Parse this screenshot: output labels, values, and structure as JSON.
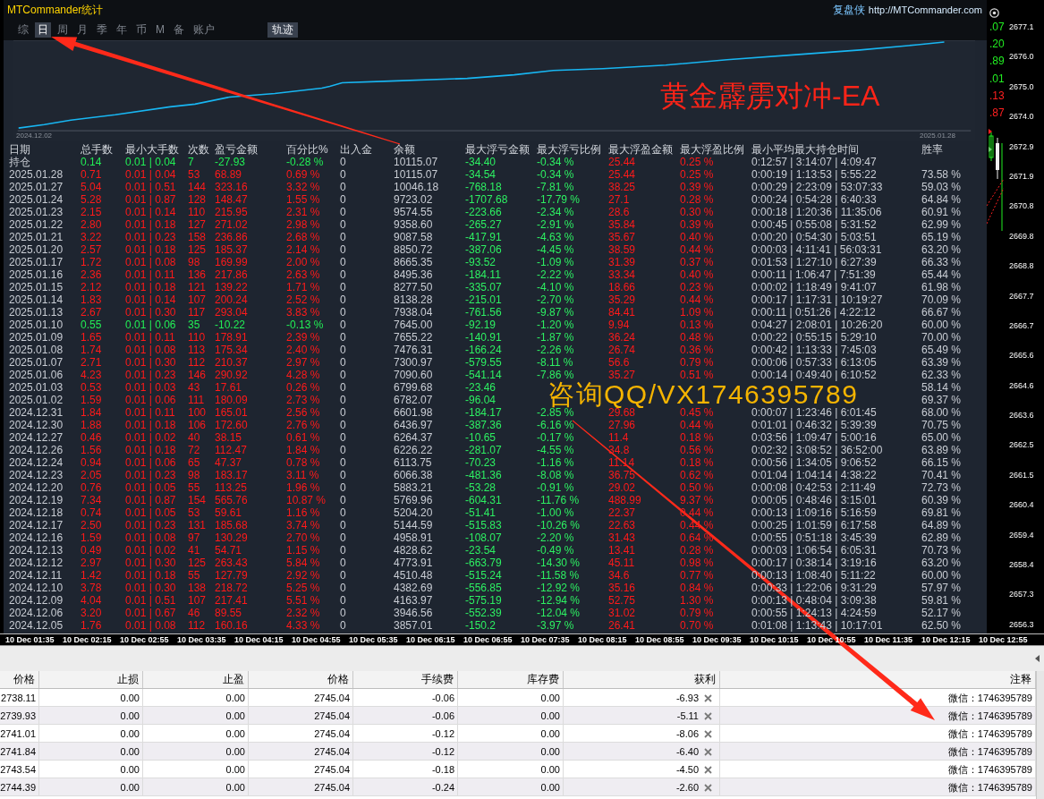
{
  "window": {
    "title": "MTCommander统计",
    "brand": "复盘侠",
    "url": "http://MTCommander.com"
  },
  "tabs": [
    {
      "label": "综",
      "selected": false
    },
    {
      "label": "日",
      "selected": true
    },
    {
      "label": "周",
      "selected": false
    },
    {
      "label": "月",
      "selected": false
    },
    {
      "label": "季",
      "selected": false
    },
    {
      "label": "年",
      "selected": false
    },
    {
      "label": "币",
      "selected": false
    },
    {
      "label": "M",
      "selected": false
    },
    {
      "label": "备",
      "selected": false
    },
    {
      "label": "账户",
      "selected": false
    }
  ],
  "track_button": {
    "label": "轨迹"
  },
  "equity_chart": {
    "start_label": "2024.12.02",
    "end_label": "2025.01.28"
  },
  "stats_table": {
    "columns": [
      "日期",
      "总手数",
      "最小大手数",
      "次数",
      "盈亏金额",
      "百分比%",
      "出入金",
      "余额",
      "最大浮亏金额",
      "最大浮亏比例",
      "最大浮盈金额",
      "最大浮盈比例",
      "最小平均最大持仓时间",
      "胜率"
    ],
    "rows": [
      {
        "color": "#22ee55",
        "cells": [
          "持仓",
          "0.14",
          "0.01 | 0.04",
          "7",
          "-27.93",
          "-0.28 %",
          "0",
          "10115.07",
          "-34.40",
          "-0.34 %",
          "25.44",
          "0.25 %",
          "0:12:57 | 3:14:07 | 4:09:47",
          null
        ]
      },
      {
        "color": "#ff1a1a",
        "cells": [
          "2025.01.28",
          "0.71",
          "0.01 | 0.04",
          "53",
          "68.89",
          "0.69 %",
          "0",
          "10115.07",
          "-34.54",
          "-0.34 %",
          "25.44",
          "0.25 %",
          "0:00:19 | 1:13:53 | 5:55:22",
          "73.58 %"
        ]
      },
      {
        "color": "#ff1a1a",
        "cells": [
          "2025.01.27",
          "5.04",
          "0.01 | 0.51",
          "144",
          "323.16",
          "3.32 %",
          "0",
          "10046.18",
          "-768.18",
          "-7.81 %",
          "38.25",
          "0.39 %",
          "0:00:29 | 2:23:09 | 53:07:33",
          "59.03 %"
        ]
      },
      {
        "color": "#ff1a1a",
        "cells": [
          "2025.01.24",
          "5.28",
          "0.01 | 0.87",
          "128",
          "148.47",
          "1.55 %",
          "0",
          "9723.02",
          "-1707.68",
          "-17.79 %",
          "27.1",
          "0.28 %",
          "0:00:24 | 0:54:28 | 6:40:33",
          "64.84 %"
        ]
      },
      {
        "color": "#ff1a1a",
        "cells": [
          "2025.01.23",
          "2.15",
          "0.01 | 0.14",
          "110",
          "215.95",
          "2.31 %",
          "0",
          "9574.55",
          "-223.66",
          "-2.34 %",
          "28.6",
          "0.30 %",
          "0:00:18 | 1:20:36 | 11:35:06",
          "60.91 %"
        ]
      },
      {
        "color": "#ff1a1a",
        "cells": [
          "2025.01.22",
          "2.80",
          "0.01 | 0.18",
          "127",
          "271.02",
          "2.98 %",
          "0",
          "9358.60",
          "-265.27",
          "-2.91 %",
          "35.84",
          "0.39 %",
          "0:00:45 | 0:55:08 | 5:31:52",
          "62.99 %"
        ]
      },
      {
        "color": "#ff1a1a",
        "cells": [
          "2025.01.21",
          "3.22",
          "0.01 | 0.23",
          "158",
          "236.86",
          "2.68 %",
          "0",
          "9087.58",
          "-417.91",
          "-4.63 %",
          "35.67",
          "0.40 %",
          "0:00:20 | 0:54:30 | 5:03:51",
          "65.19 %"
        ]
      },
      {
        "color": "#ff1a1a",
        "cells": [
          "2025.01.20",
          "2.57",
          "0.01 | 0.18",
          "125",
          "185.37",
          "2.14 %",
          "0",
          "8850.72",
          "-387.06",
          "-4.45 %",
          "38.59",
          "0.44 %",
          "0:00:03 | 4:11:41 | 56:03:31",
          "63.20 %"
        ]
      },
      {
        "color": "#ff1a1a",
        "cells": [
          "2025.01.17",
          "1.72",
          "0.01 | 0.08",
          "98",
          "169.99",
          "2.00 %",
          "0",
          "8665.35",
          "-93.52",
          "-1.09 %",
          "31.39",
          "0.37 %",
          "0:01:53 | 1:27:10 | 6:27:39",
          "66.33 %"
        ]
      },
      {
        "color": "#ff1a1a",
        "cells": [
          "2025.01.16",
          "2.36",
          "0.01 | 0.11",
          "136",
          "217.86",
          "2.63 %",
          "0",
          "8495.36",
          "-184.11",
          "-2.22 %",
          "33.34",
          "0.40 %",
          "0:00:11 | 1:06:47 | 7:51:39",
          "65.44 %"
        ]
      },
      {
        "color": "#ff1a1a",
        "cells": [
          "2025.01.15",
          "2.12",
          "0.01 | 0.18",
          "121",
          "139.22",
          "1.71 %",
          "0",
          "8277.50",
          "-335.07",
          "-4.10 %",
          "18.66",
          "0.23 %",
          "0:00:02 | 1:18:49 | 9:41:07",
          "61.98 %"
        ]
      },
      {
        "color": "#ff1a1a",
        "cells": [
          "2025.01.14",
          "1.83",
          "0.01 | 0.14",
          "107",
          "200.24",
          "2.52 %",
          "0",
          "8138.28",
          "-215.01",
          "-2.70 %",
          "35.29",
          "0.44 %",
          "0:00:17 | 1:17:31 | 10:19:27",
          "70.09 %"
        ]
      },
      {
        "color": "#ff1a1a",
        "cells": [
          "2025.01.13",
          "2.67",
          "0.01 | 0.30",
          "117",
          "293.04",
          "3.83 %",
          "0",
          "7938.04",
          "-761.56",
          "-9.87 %",
          "84.41",
          "1.09 %",
          "0:00:11 | 0:51:26 | 4:22:12",
          "66.67 %"
        ]
      },
      {
        "color": "#22ee55",
        "cells": [
          "2025.01.10",
          "0.55",
          "0.01 | 0.06",
          "35",
          "-10.22",
          "-0.13 %",
          "0",
          "7645.00",
          "-92.19",
          "-1.20 %",
          "9.94",
          "0.13 %",
          "0:04:27 | 2:08:01 | 10:26:20",
          "60.00 %"
        ]
      },
      {
        "color": "#ff1a1a",
        "cells": [
          "2025.01.09",
          "1.65",
          "0.01 | 0.11",
          "110",
          "178.91",
          "2.39 %",
          "0",
          "7655.22",
          "-140.91",
          "-1.87 %",
          "36.24",
          "0.48 %",
          "0:00:22 | 0:55:15 | 5:29:10",
          "70.00 %"
        ]
      },
      {
        "color": "#ff1a1a",
        "cells": [
          "2025.01.08",
          "1.74",
          "0.01 | 0.08",
          "113",
          "175.34",
          "2.40 %",
          "0",
          "7476.31",
          "-166.24",
          "-2.26 %",
          "26.74",
          "0.36 %",
          "0:00:42 | 1:13:33 | 7:45:03",
          "65.49 %"
        ]
      },
      {
        "color": "#ff1a1a",
        "cells": [
          "2025.01.07",
          "2.71",
          "0.01 | 0.30",
          "112",
          "210.37",
          "2.97 %",
          "0",
          "7300.97",
          "-579.55",
          "-8.11 %",
          "56.6",
          "0.79 %",
          "0:00:06 | 0:57:33 | 6:13:05",
          "63.39 %"
        ]
      },
      {
        "color": "#ff1a1a",
        "cells": [
          "2025.01.06",
          "4.23",
          "0.01 | 0.23",
          "146",
          "290.92",
          "4.28 %",
          "0",
          "7090.60",
          "-541.14",
          "-7.86 %",
          "35.27",
          "0.51 %",
          "0:00:14 | 0:49:40 | 6:10:52",
          "62.33 %"
        ]
      },
      {
        "color": "#ff1a1a",
        "cells": [
          "2025.01.03",
          "0.53",
          "0.01 | 0.03",
          "43",
          "17.61",
          "0.26 %",
          "0",
          "6799.68",
          "-23.46",
          null,
          null,
          null,
          null,
          "58.14 %"
        ]
      },
      {
        "color": "#ff1a1a",
        "cells": [
          "2025.01.02",
          "1.59",
          "0.01 | 0.06",
          "111",
          "180.09",
          "2.73 %",
          "0",
          "6782.07",
          "-96.04",
          null,
          null,
          null,
          null,
          "69.37 %"
        ]
      },
      {
        "color": "#ff1a1a",
        "cells": [
          "2024.12.31",
          "1.84",
          "0.01 | 0.11",
          "100",
          "165.01",
          "2.56 %",
          "0",
          "6601.98",
          "-184.17",
          "-2.85 %",
          "29.68",
          "0.45 %",
          "0:00:07 | 1:23:46 | 6:01:45",
          "68.00 %"
        ]
      },
      {
        "color": "#ff1a1a",
        "cells": [
          "2024.12.30",
          "1.88",
          "0.01 | 0.18",
          "106",
          "172.60",
          "2.76 %",
          "0",
          "6436.97",
          "-387.36",
          "-6.16 %",
          "27.96",
          "0.44 %",
          "0:01:01 | 0:46:32 | 5:39:39",
          "70.75 %"
        ]
      },
      {
        "color": "#ff1a1a",
        "cells": [
          "2024.12.27",
          "0.46",
          "0.01 | 0.02",
          "40",
          "38.15",
          "0.61 %",
          "0",
          "6264.37",
          "-10.65",
          "-0.17 %",
          "11.4",
          "0.18 %",
          "0:03:56 | 1:09:47 | 5:00:16",
          "65.00 %"
        ]
      },
      {
        "color": "#ff1a1a",
        "cells": [
          "2024.12.26",
          "1.56",
          "0.01 | 0.18",
          "72",
          "112.47",
          "1.84 %",
          "0",
          "6226.22",
          "-281.07",
          "-4.55 %",
          "34.8",
          "0.56 %",
          "0:02:32 | 3:08:52 | 36:52:00",
          "63.89 %"
        ]
      },
      {
        "color": "#ff1a1a",
        "cells": [
          "2024.12.24",
          "0.94",
          "0.01 | 0.06",
          "65",
          "47.37",
          "0.78 %",
          "0",
          "6113.75",
          "-70.23",
          "-1.16 %",
          "11.14",
          "0.18 %",
          "0:00:56 | 1:34:05 | 9:06:52",
          "66.15 %"
        ]
      },
      {
        "color": "#ff1a1a",
        "cells": [
          "2024.12.23",
          "2.05",
          "0.01 | 0.23",
          "98",
          "183.17",
          "3.11 %",
          "0",
          "6066.38",
          "-481.36",
          "-8.08 %",
          "36.75",
          "0.62 %",
          "0:01:04 | 1:04:14 | 4:38:22",
          "70.41 %"
        ]
      },
      {
        "color": "#ff1a1a",
        "cells": [
          "2024.12.20",
          "0.76",
          "0.01 | 0.05",
          "55",
          "113.25",
          "1.96 %",
          "0",
          "5883.21",
          "-53.28",
          "-0.91 %",
          "29.02",
          "0.50 %",
          "0:00:08 | 0:42:53 | 2:11:49",
          "72.73 %"
        ]
      },
      {
        "color": "#ff1a1a",
        "cells": [
          "2024.12.19",
          "7.34",
          "0.01 | 0.87",
          "154",
          "565.76",
          "10.87 %",
          "0",
          "5769.96",
          "-604.31",
          "-11.76 %",
          "488.99",
          "9.37 %",
          "0:00:05 | 0:48:46 | 3:15:01",
          "60.39 %"
        ]
      },
      {
        "color": "#ff1a1a",
        "cells": [
          "2024.12.18",
          "0.74",
          "0.01 | 0.05",
          "53",
          "59.61",
          "1.16 %",
          "0",
          "5204.20",
          "-51.41",
          "-1.00 %",
          "22.37",
          "0.44 %",
          "0:00:13 | 1:09:16 | 5:16:59",
          "69.81 %"
        ]
      },
      {
        "color": "#ff1a1a",
        "cells": [
          "2024.12.17",
          "2.50",
          "0.01 | 0.23",
          "131",
          "185.68",
          "3.74 %",
          "0",
          "5144.59",
          "-515.83",
          "-10.26 %",
          "22.63",
          "0.44 %",
          "0:00:25 | 1:01:59 | 6:17:58",
          "64.89 %"
        ]
      },
      {
        "color": "#ff1a1a",
        "cells": [
          "2024.12.16",
          "1.59",
          "0.01 | 0.08",
          "97",
          "130.29",
          "2.70 %",
          "0",
          "4958.91",
          "-108.07",
          "-2.20 %",
          "31.43",
          "0.64 %",
          "0:00:55 | 0:51:18 | 3:45:39",
          "62.89 %"
        ]
      },
      {
        "color": "#ff1a1a",
        "cells": [
          "2024.12.13",
          "0.49",
          "0.01 | 0.02",
          "41",
          "54.71",
          "1.15 %",
          "0",
          "4828.62",
          "-23.54",
          "-0.49 %",
          "13.41",
          "0.28 %",
          "0:00:03 | 1:06:54 | 6:05:31",
          "70.73 %"
        ]
      },
      {
        "color": "#ff1a1a",
        "cells": [
          "2024.12.12",
          "2.97",
          "0.01 | 0.30",
          "125",
          "263.43",
          "5.84 %",
          "0",
          "4773.91",
          "-663.79",
          "-14.30 %",
          "45.11",
          "0.98 %",
          "0:00:17 | 0:38:14 | 3:19:16",
          "63.20 %"
        ]
      },
      {
        "color": "#ff1a1a",
        "cells": [
          "2024.12.11",
          "1.42",
          "0.01 | 0.18",
          "55",
          "127.79",
          "2.92 %",
          "0",
          "4510.48",
          "-515.24",
          "-11.58 %",
          "34.6",
          "0.77 %",
          "0:00:13 | 1:08:40 | 5:11:22",
          "60.00 %"
        ]
      },
      {
        "color": "#ff1a1a",
        "cells": [
          "2024.12.10",
          "3.78",
          "0.01 | 0.30",
          "138",
          "218.72",
          "5.25 %",
          "0",
          "4382.69",
          "-556.85",
          "-12.92 %",
          "35.16",
          "0.84 %",
          "0:00:33 | 1:22:06 | 9:31:29",
          "57.97 %"
        ]
      },
      {
        "color": "#ff1a1a",
        "cells": [
          "2024.12.09",
          "4.04",
          "0.01 | 0.51",
          "107",
          "217.41",
          "5.51 %",
          "0",
          "4163.97",
          "-575.19",
          "-12.94 %",
          "52.75",
          "1.30 %",
          "0:00:13 | 0:48:04 | 3:09:38",
          "59.81 %"
        ]
      },
      {
        "color": "#ff1a1a",
        "cells": [
          "2024.12.06",
          "3.20",
          "0.01 | 0.67",
          "46",
          "89.55",
          "2.32 %",
          "0",
          "3946.56",
          "-552.39",
          "-12.04 %",
          "31.02",
          "0.79 %",
          "0:00:55 | 1:24:13 | 4:24:59",
          "52.17 %"
        ]
      },
      {
        "color": "#ff1a1a",
        "cells": [
          "2024.12.05",
          "1.76",
          "0.01 | 0.08",
          "112",
          "160.16",
          "4.33 %",
          "0",
          "3857.01",
          "-150.2",
          "-3.97 %",
          "26.41",
          "0.70 %",
          "0:01:08 | 1:13:43 | 10:17:01",
          "62.50 %"
        ]
      }
    ]
  },
  "quote_values": [
    {
      "text": ".07",
      "color": "#22ee22"
    },
    {
      "text": ".20",
      "color": "#22ee22"
    },
    {
      "text": ".89",
      "color": "#22ee22"
    },
    {
      "text": ".01",
      "color": "#22ee22"
    },
    {
      "text": ".13",
      "color": "#ff2020"
    },
    {
      "text": ".87",
      "color": "#ff2020"
    }
  ],
  "price_axis": [
    "2677.1",
    "2676.0",
    "2675.0",
    "2674.0",
    "2672.9",
    "2671.9",
    "2670.8",
    "2669.8",
    "2668.8",
    "2667.7",
    "2666.7",
    "2665.6",
    "2664.6",
    "2663.6",
    "2662.5",
    "2661.5",
    "2660.4",
    "2659.4",
    "2658.4",
    "2657.3",
    "2656.3"
  ],
  "time_axis": [
    "10 Dec 01:35",
    "10 Dec 02:15",
    "10 Dec 02:55",
    "10 Dec 03:35",
    "10 Dec 04:15",
    "10 Dec 04:55",
    "10 Dec 05:35",
    "10 Dec 06:15",
    "10 Dec 06:55",
    "10 Dec 07:35",
    "10 Dec 08:15",
    "10 Dec 08:55",
    "10 Dec 09:35",
    "10 Dec 10:15",
    "10 Dec 10:55",
    "10 Dec 11:35",
    "10 Dec 12:15",
    "10 Dec 12:55"
  ],
  "orders_table": {
    "columns": [
      "价格",
      "止损",
      "止盈",
      "价格",
      "手续费",
      "库存费",
      "获利",
      "注释"
    ],
    "rows": [
      [
        "2738.11",
        "0.00",
        "0.00",
        "2745.04",
        "-0.06",
        "0.00",
        "-6.93",
        "微信：1746395789"
      ],
      [
        "2739.93",
        "0.00",
        "0.00",
        "2745.04",
        "-0.06",
        "0.00",
        "-5.11",
        "微信：1746395789"
      ],
      [
        "2741.01",
        "0.00",
        "0.00",
        "2745.04",
        "-0.12",
        "0.00",
        "-8.06",
        "微信：1746395789"
      ],
      [
        "2741.84",
        "0.00",
        "0.00",
        "2745.04",
        "-0.12",
        "0.00",
        "-6.40",
        "微信：1746395789"
      ],
      [
        "2743.54",
        "0.00",
        "0.00",
        "2745.04",
        "-0.18",
        "0.00",
        "-4.50",
        "微信：1746395789"
      ],
      [
        "2744.39",
        "0.00",
        "0.00",
        "2745.04",
        "-0.24",
        "0.00",
        "-2.60",
        "微信：1746395789"
      ]
    ]
  },
  "annotations": {
    "title": "黄金霹雳对冲-EA",
    "contact": "咨询QQ/VX1746395789"
  }
}
